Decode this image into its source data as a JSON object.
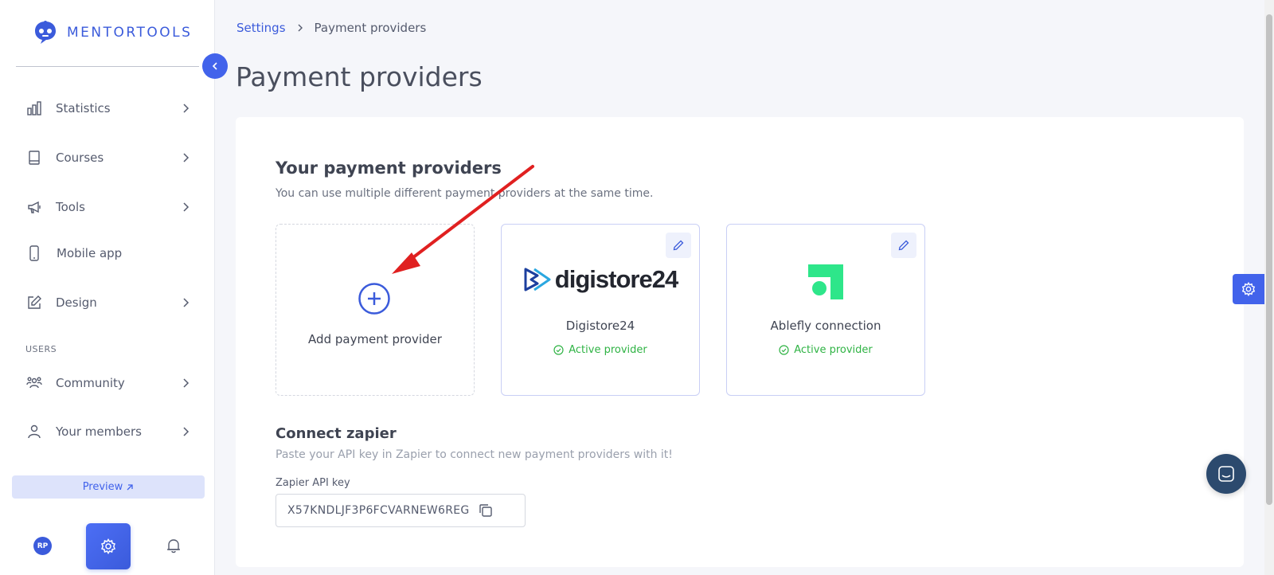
{
  "brand": {
    "name": "MENTORTOOLS"
  },
  "sidebar": {
    "items": [
      {
        "label": "Statistics"
      },
      {
        "label": "Courses"
      },
      {
        "label": "Tools"
      },
      {
        "label": "Mobile app"
      },
      {
        "label": "Design"
      },
      {
        "label": "Community"
      },
      {
        "label": "Your members"
      }
    ],
    "users_section": "USERS",
    "preview_label": "Preview",
    "avatar_initials": "RP"
  },
  "breadcrumb": {
    "root": "Settings",
    "current": "Payment providers"
  },
  "page": {
    "title": "Payment providers"
  },
  "providers": {
    "title": "Your payment providers",
    "subtitle": "You can use multiple different payment providers at the same time.",
    "add_label": "Add payment provider",
    "items": [
      {
        "name": "Digistore24",
        "logo_text": "digistore24",
        "status": "Active provider"
      },
      {
        "name": "Ablefly connection",
        "status": "Active provider"
      }
    ]
  },
  "zapier": {
    "title": "Connect zapier",
    "subtitle": "Paste your API key in Zapier to connect new payment providers with it!",
    "field_label": "Zapier API key",
    "api_key": "X57KNDLJF3P6FCVARNEW6REG"
  },
  "colors": {
    "accent": "#4263eb",
    "active": "#2fb344",
    "annotation": "#e02020"
  }
}
